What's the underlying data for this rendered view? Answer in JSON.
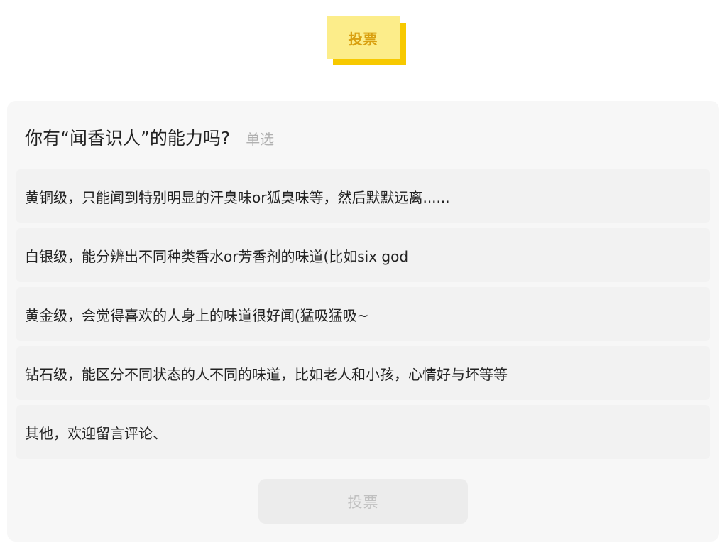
{
  "header": {
    "badge_label": "投票"
  },
  "poll": {
    "question": "你有“闻香识人”的能力吗?",
    "type_label": "单选",
    "options": [
      {
        "label": "黄铜级，只能闻到特别明显的汗臭味or狐臭味等，然后默默远离......"
      },
      {
        "label": "白银级，能分辨出不同种类香水or芳香剂的味道(比如six god"
      },
      {
        "label": "黄金级，会觉得喜欢的人身上的味道很好闻(猛吸猛吸~"
      },
      {
        "label": "钻石级，能区分不同状态的人不同的味道，比如老人和小孩，心情好与坏等等"
      },
      {
        "label": "其他，欢迎留言评论、"
      }
    ],
    "submit_label": "投票"
  },
  "colors": {
    "badge_bg": "#fced8a",
    "badge_shadow": "#f7c900",
    "badge_text": "#d9a010",
    "card_bg": "#f7f7f7",
    "option_bg": "#f2f2f2",
    "submit_bg": "#ececec",
    "submit_text": "#c0c0c0"
  }
}
